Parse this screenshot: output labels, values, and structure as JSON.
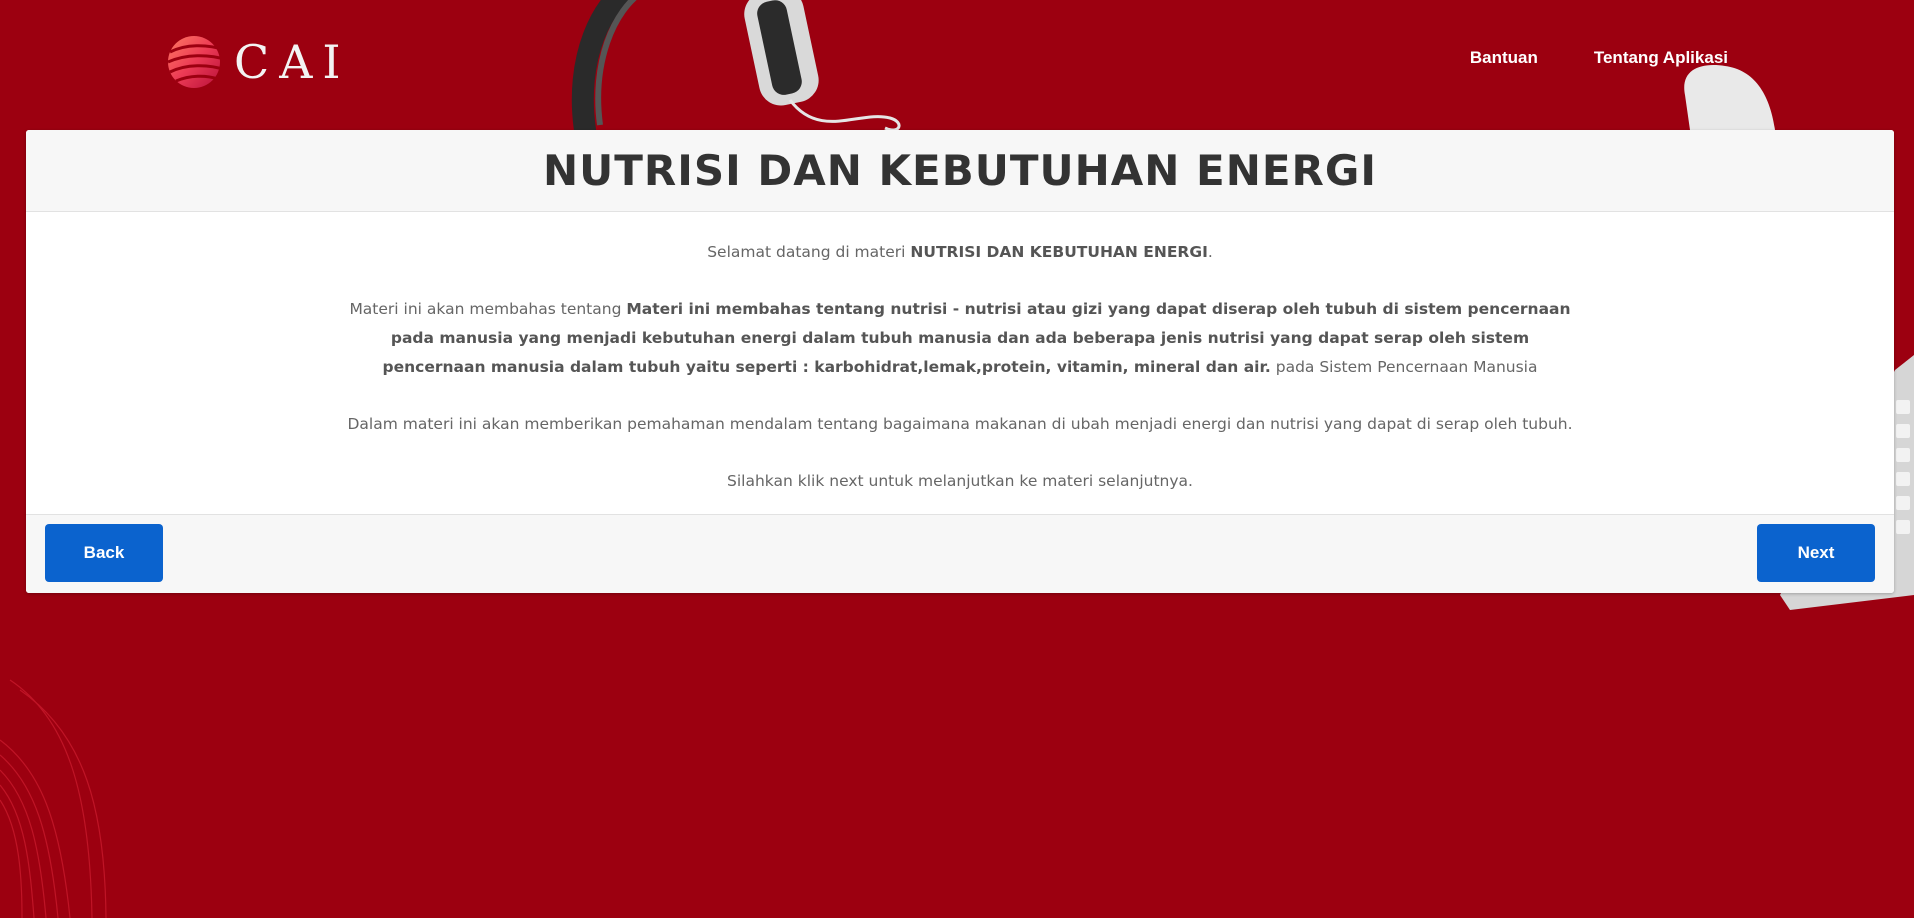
{
  "brand": {
    "logo_text": "CAI",
    "logo_colors": [
      "#ff6a5c",
      "#e8334f",
      "#c4123a"
    ]
  },
  "nav": {
    "items": [
      {
        "label": "Bantuan"
      },
      {
        "label": "Tentang Aplikasi"
      }
    ]
  },
  "card": {
    "title": "NUTRISI DAN KEBUTUHAN ENERGI",
    "intro": {
      "before": "Selamat datang di materi ",
      "bold": "NUTRISI DAN KEBUTUHAN ENERGI",
      "after": "."
    },
    "description": {
      "before": "Materi ini akan membahas tentang ",
      "bold": "Materi ini membahas tentang nutrisi - nutrisi atau gizi yang dapat diserap oleh tubuh di sistem pencernaan pada manusia yang menjadi kebutuhan energi dalam tubuh manusia dan ada beberapa jenis nutrisi yang dapat serap oleh sistem pencernaan manusia dalam tubuh yaitu seperti : karbohidrat,lemak,protein, vitamin, mineral dan air.",
      "after": " pada Sistem Pencernaan Manusia"
    },
    "detail": "Dalam materi ini akan memberikan pemahaman mendalam tentang bagaimana makanan di ubah menjadi energi dan nutrisi yang dapat di serap oleh tubuh.",
    "instruction": "Silahkan klik next untuk melanjutkan ke materi selanjutnya."
  },
  "footer": {
    "back_label": "Back",
    "next_label": "Next"
  },
  "colors": {
    "background": "#9c0010",
    "button": "#0b63ce",
    "header_bg": "#f7f7f7"
  }
}
